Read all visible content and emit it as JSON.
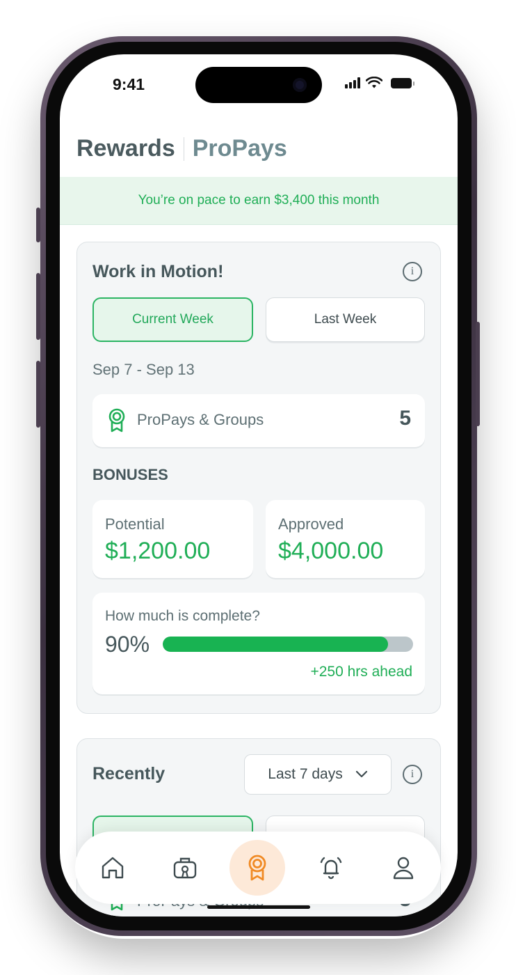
{
  "status_bar": {
    "time": "9:41"
  },
  "header": {
    "title": "Rewards",
    "subtitle": "ProPays"
  },
  "banner": {
    "text": "You’re on pace to earn $3,400 this month"
  },
  "work_in_motion": {
    "title": "Work in Motion!",
    "tabs": [
      {
        "label": "Current Week",
        "active": true
      },
      {
        "label": "Last Week",
        "active": false
      }
    ],
    "date_range": "Sep 7 - Sep 13",
    "propays": {
      "label": "ProPays & Groups",
      "count": "5"
    },
    "bonuses_heading": "BONUSES",
    "potential": {
      "label": "Potential",
      "value": "$1,200.00"
    },
    "approved": {
      "label": "Approved",
      "value": "$4,000.00"
    },
    "completion": {
      "question": "How much is complete?",
      "percent_label": "90%",
      "percent": 90,
      "ahead": "+250 hrs ahead"
    }
  },
  "recently": {
    "title": "Recently",
    "range_select": "Last 7 days",
    "propays_label": "ProPays & Groups",
    "propays_count": "5"
  },
  "tabbar": {
    "items": [
      {
        "icon": "home-icon",
        "active": false
      },
      {
        "icon": "briefcase-icon",
        "active": false
      },
      {
        "icon": "medal-icon",
        "active": true
      },
      {
        "icon": "bell-icon",
        "active": false
      },
      {
        "icon": "user-icon",
        "active": false
      }
    ]
  },
  "colors": {
    "accent_green": "#1fae56",
    "active_tab_orange": "#f08a24",
    "text_dark": "#46575b"
  }
}
